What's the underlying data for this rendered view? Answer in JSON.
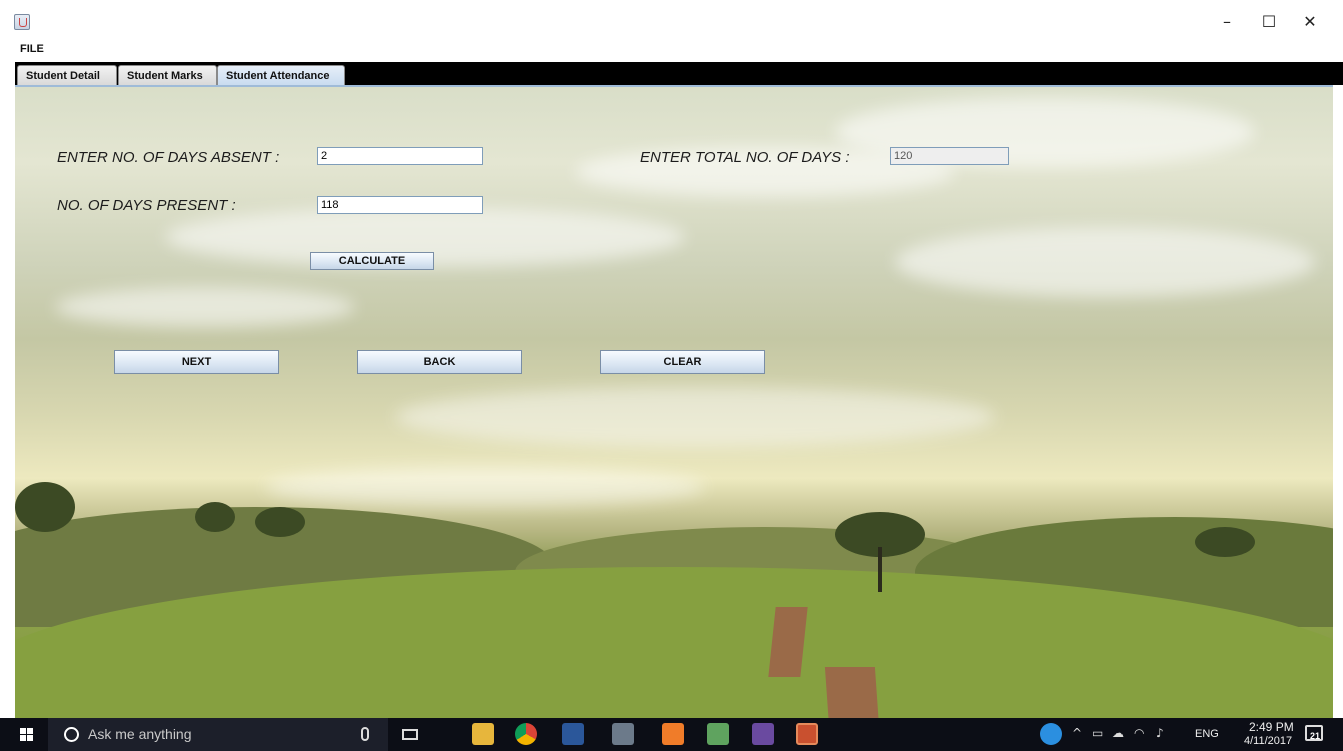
{
  "window": {
    "minimize_glyph": "–",
    "maximize_glyph": "☐",
    "close_glyph": "✕"
  },
  "menu": {
    "file_label": "FILE"
  },
  "tabs": [
    {
      "label": "Student Detail"
    },
    {
      "label": "Student Marks"
    },
    {
      "label": "Student Attendance",
      "selected": true
    }
  ],
  "form": {
    "absent_label": "ENTER NO. OF DAYS ABSENT :",
    "absent_value": "2",
    "total_label": "ENTER TOTAL NO. OF DAYS :",
    "total_value": "120",
    "present_label": "NO. OF DAYS PRESENT :",
    "present_value": "118",
    "calculate_label": "CALCULATE",
    "next_label": "NEXT",
    "back_label": "BACK",
    "clear_label": "CLEAR"
  },
  "taskbar": {
    "search_placeholder": "Ask me anything",
    "language": "ENG",
    "time": "2:49 PM",
    "date": "4/11/2017",
    "notification_count": "21",
    "apps": [
      "file-explorer-icon",
      "chrome-icon",
      "word-icon",
      "tools-icon",
      "xampp-icon",
      "notepad-icon",
      "game-icon",
      "java-icon"
    ],
    "colors": {
      "taskbar_bg": "#0c0e16",
      "search_bg": "#1c1f2a"
    }
  }
}
